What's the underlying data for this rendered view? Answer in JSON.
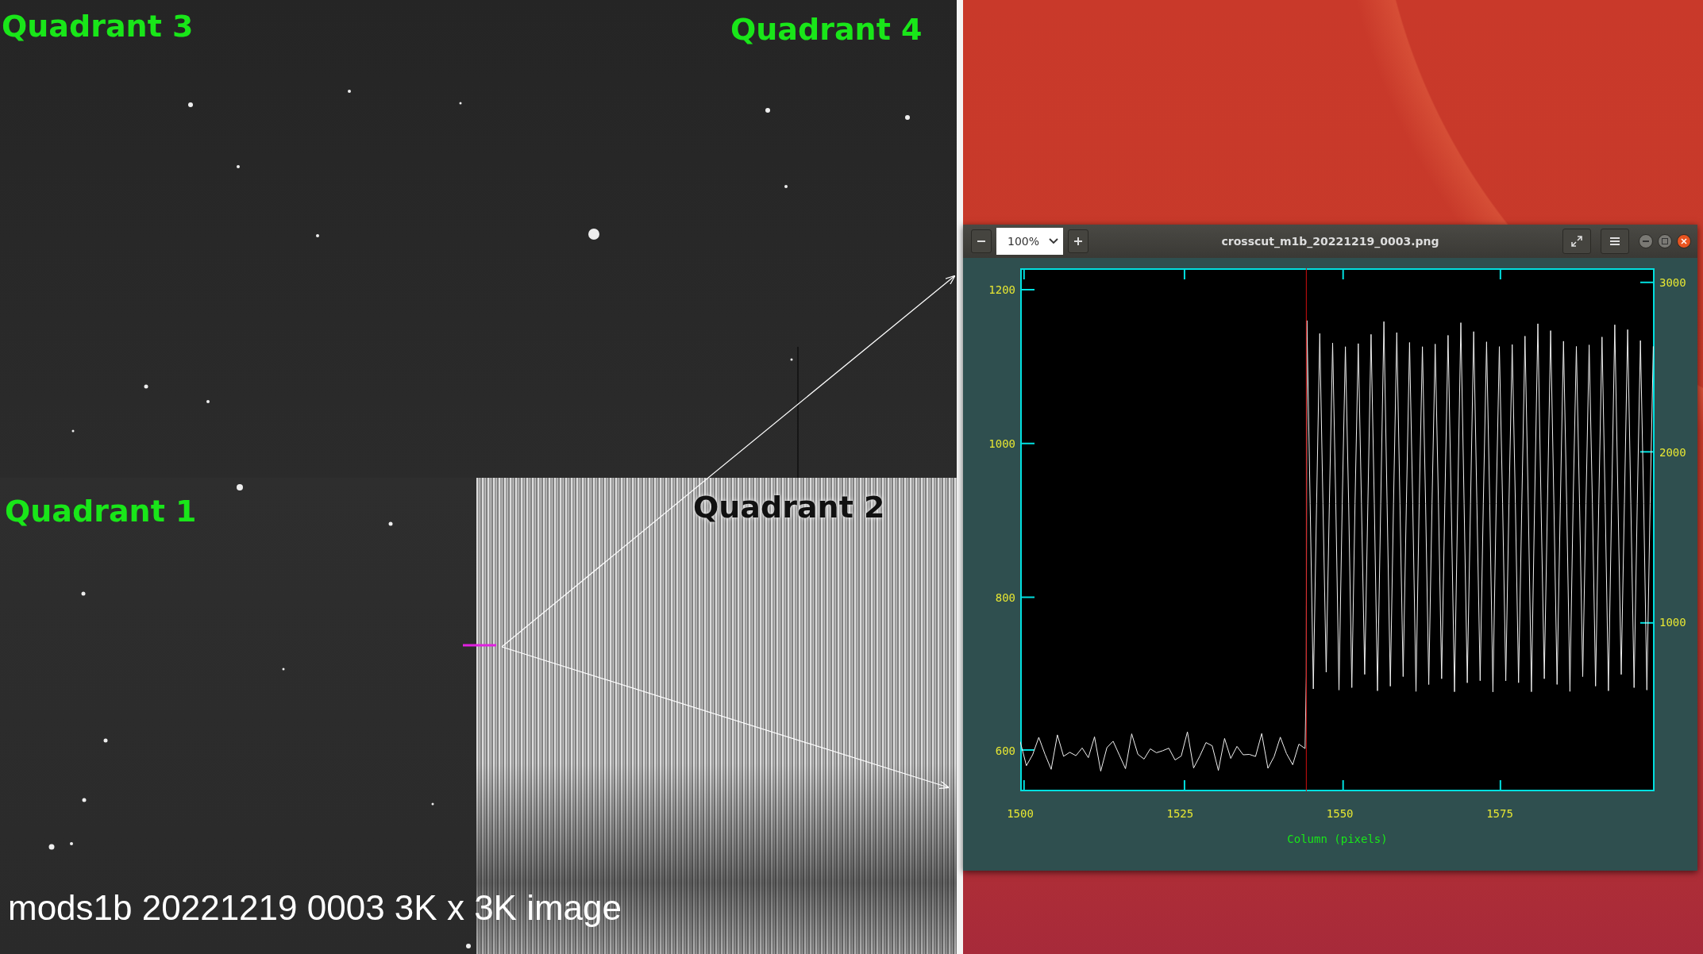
{
  "image_panel": {
    "quadrant_labels": [
      "Quadrant 3",
      "Quadrant 4",
      "Quadrant 1",
      "Quadrant 2"
    ],
    "caption": "mods1b 20221219 0003 3K x 3K image"
  },
  "viewer_window": {
    "zoom": "100%",
    "title": "crosscut_m1b_20221219_0003.png",
    "plot": {
      "left_y_ticks": [
        "1200",
        "1000",
        "800",
        "600"
      ],
      "right_y_ticks": [
        "3000",
        "2000",
        "1000"
      ],
      "x_ticks": [
        "1500",
        "1525",
        "1550",
        "1575"
      ],
      "xlabel": "Column (pixels)"
    }
  }
}
